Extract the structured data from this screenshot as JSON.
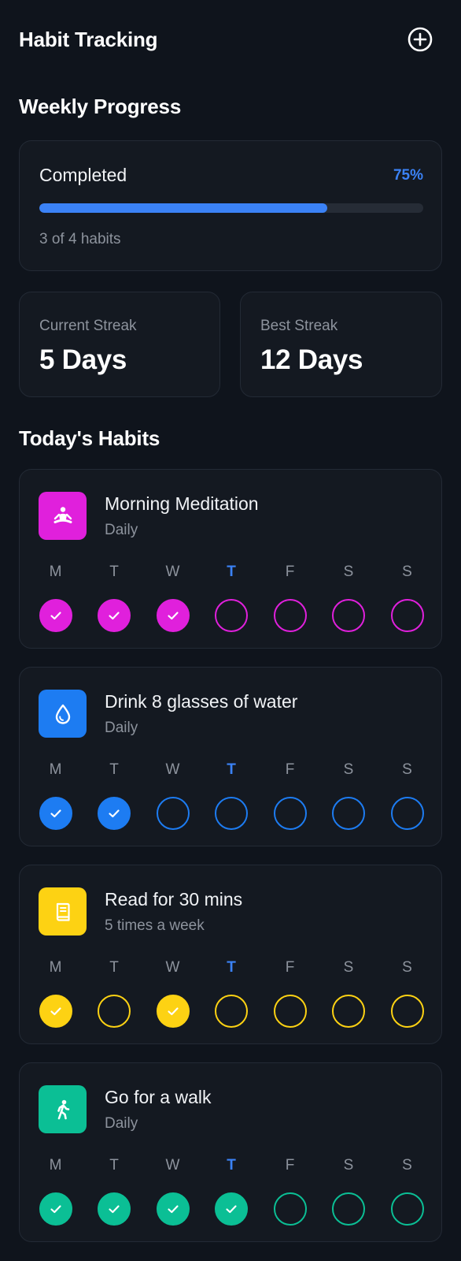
{
  "header": {
    "title": "Habit Tracking",
    "add_icon": "plus-circle-icon"
  },
  "weekly": {
    "title": "Weekly Progress",
    "completed_label": "Completed",
    "percent_text": "75%",
    "progress": 0.75,
    "subtext": "3 of 4 habits",
    "accent": "#3b82f6"
  },
  "streaks": {
    "current": {
      "label": "Current Streak",
      "value": "5 Days"
    },
    "best": {
      "label": "Best Streak",
      "value": "12 Days"
    }
  },
  "today": {
    "title": "Today's Habits"
  },
  "days": [
    "M",
    "T",
    "W",
    "T",
    "F",
    "S",
    "S"
  ],
  "today_index": 3,
  "habits": [
    {
      "name": "Morning Meditation",
      "frequency": "Daily",
      "icon": "meditation-icon",
      "color": "#e020dc",
      "done": [
        true,
        true,
        true,
        false,
        false,
        false,
        false
      ]
    },
    {
      "name": "Drink 8 glasses of water",
      "frequency": "Daily",
      "icon": "water-drop-icon",
      "color": "#1d7cf2",
      "done": [
        true,
        true,
        false,
        false,
        false,
        false,
        false
      ]
    },
    {
      "name": "Read for 30 mins",
      "frequency": "5 times a week",
      "icon": "book-icon",
      "color": "#fdd213",
      "done": [
        true,
        false,
        true,
        false,
        false,
        false,
        false
      ]
    },
    {
      "name": "Go for a walk",
      "frequency": "Daily",
      "icon": "walking-icon",
      "color": "#0bbf95",
      "done": [
        true,
        true,
        true,
        true,
        false,
        false,
        false
      ]
    }
  ]
}
